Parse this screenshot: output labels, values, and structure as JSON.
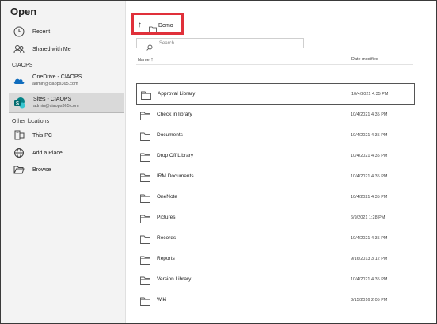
{
  "app": {
    "title": "Open"
  },
  "sidebar": {
    "recent": {
      "label": "Recent"
    },
    "shared": {
      "label": "Shared with Me"
    },
    "org_heading": "CIAOPS",
    "onedrive": {
      "label": "OneDrive - CIAOPS",
      "sub": "admin@ciaops365.com"
    },
    "sites": {
      "label": "Sites - CIAOPS",
      "sub": "admin@ciaops365.com"
    },
    "other_heading": "Other locations",
    "thispc": {
      "label": "This PC"
    },
    "addplace": {
      "label": "Add a Place"
    },
    "browse": {
      "label": "Browse"
    }
  },
  "breadcrumb": {
    "folder": "Demo"
  },
  "search": {
    "placeholder": "Search"
  },
  "columns": {
    "name": "Name",
    "sort_arrow": "↑",
    "date": "Date modified"
  },
  "files": [
    {
      "name": "Approval Library",
      "date": "10/4/2021 4:35 PM"
    },
    {
      "name": "Check in library",
      "date": "10/4/2021 4:35 PM"
    },
    {
      "name": "Documents",
      "date": "10/4/2021 4:35 PM"
    },
    {
      "name": "Drop Off Library",
      "date": "10/4/2021 4:35 PM"
    },
    {
      "name": "IRM Documents",
      "date": "10/4/2021 4:35 PM"
    },
    {
      "name": "OneNote",
      "date": "10/4/2021 4:35 PM"
    },
    {
      "name": "Pictures",
      "date": "6/9/2021 1:28 PM"
    },
    {
      "name": "Records",
      "date": "10/4/2021 4:35 PM"
    },
    {
      "name": "Reports",
      "date": "9/16/2013 3:12 PM"
    },
    {
      "name": "Version Library",
      "date": "10/4/2021 4:35 PM"
    },
    {
      "name": "Wiki",
      "date": "3/15/2016 2:05 PM"
    }
  ],
  "colors": {
    "highlight_box": "#e0303a",
    "sidebar_bg": "#f3f3f3",
    "onedrive_blue": "#0f6cbd",
    "sharepoint_teal": "#038387"
  }
}
